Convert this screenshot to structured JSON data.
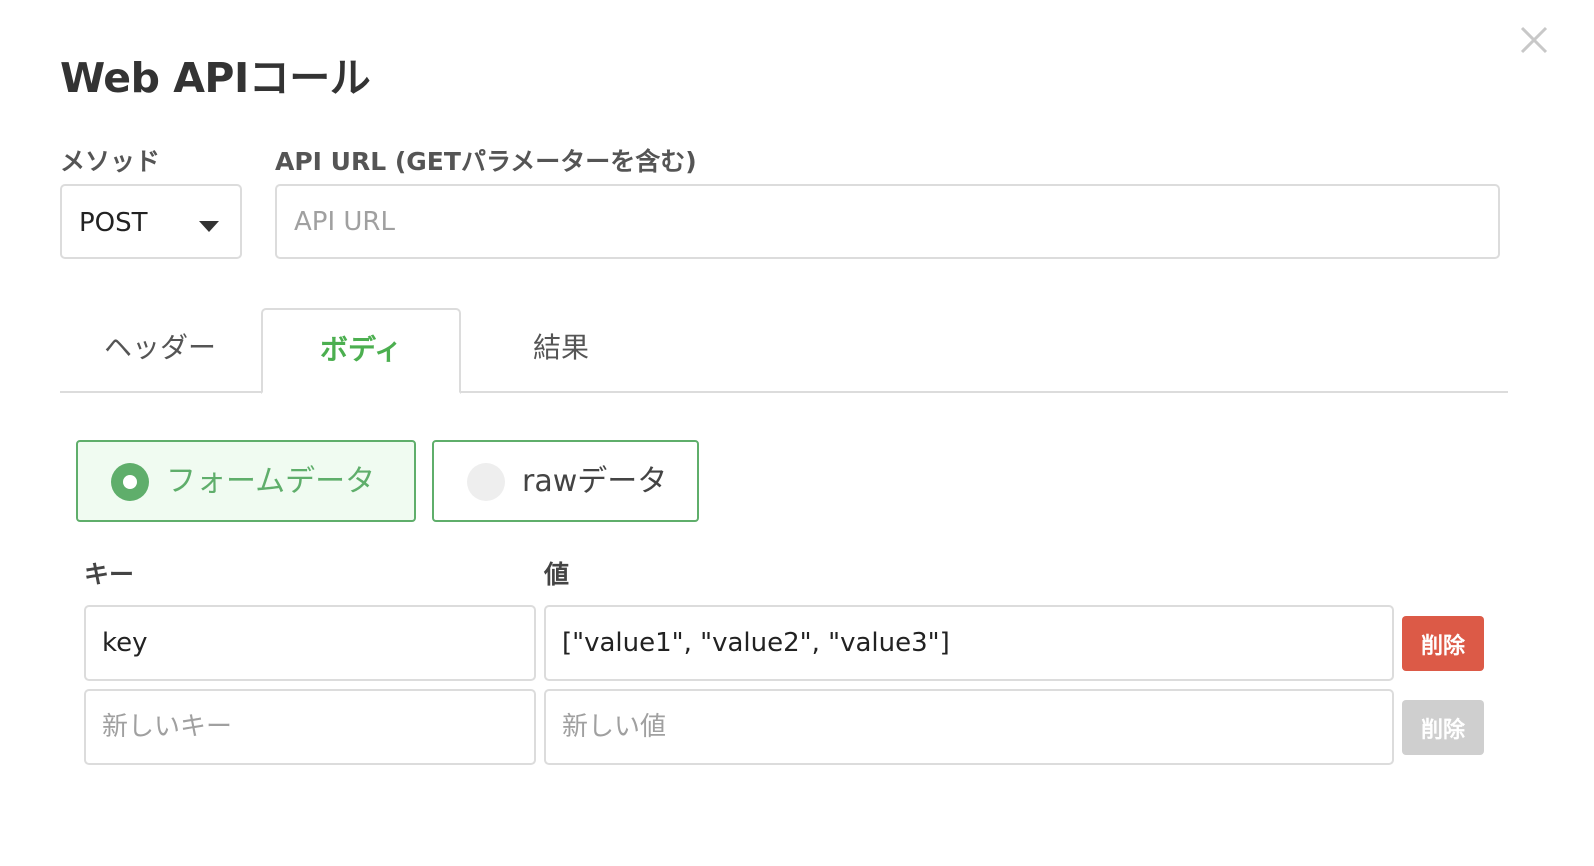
{
  "dialog": {
    "title": "Web APIコール",
    "close_icon": "close-icon"
  },
  "method": {
    "label": "メソッド",
    "selected": "POST",
    "caret_icon": "caret-down-icon"
  },
  "url": {
    "label": "API URL (GETパラメーターを含む)",
    "value": "",
    "placeholder": "API URL"
  },
  "tabs": [
    {
      "label": "ヘッダー",
      "active": false
    },
    {
      "label": "ボディ",
      "active": true
    },
    {
      "label": "結果",
      "active": false
    }
  ],
  "body_type": {
    "options": [
      {
        "label": "フォームデータ",
        "selected": true
      },
      {
        "label": "rawデータ",
        "selected": false
      }
    ]
  },
  "kv_table": {
    "key_header": "キー",
    "value_header": "値",
    "rows": [
      {
        "key": "key",
        "value": "[\"value1\", \"value2\", \"value3\"]",
        "delete_label": "削除",
        "delete_enabled": true
      },
      {
        "key": "",
        "value": "",
        "key_placeholder": "新しいキー",
        "value_placeholder": "新しい値",
        "delete_label": "削除",
        "delete_enabled": false
      }
    ]
  },
  "colors": {
    "accent_green": "#5fae6b",
    "danger_red": "#dc5a47",
    "disabled_gray": "#cfcfcf"
  }
}
